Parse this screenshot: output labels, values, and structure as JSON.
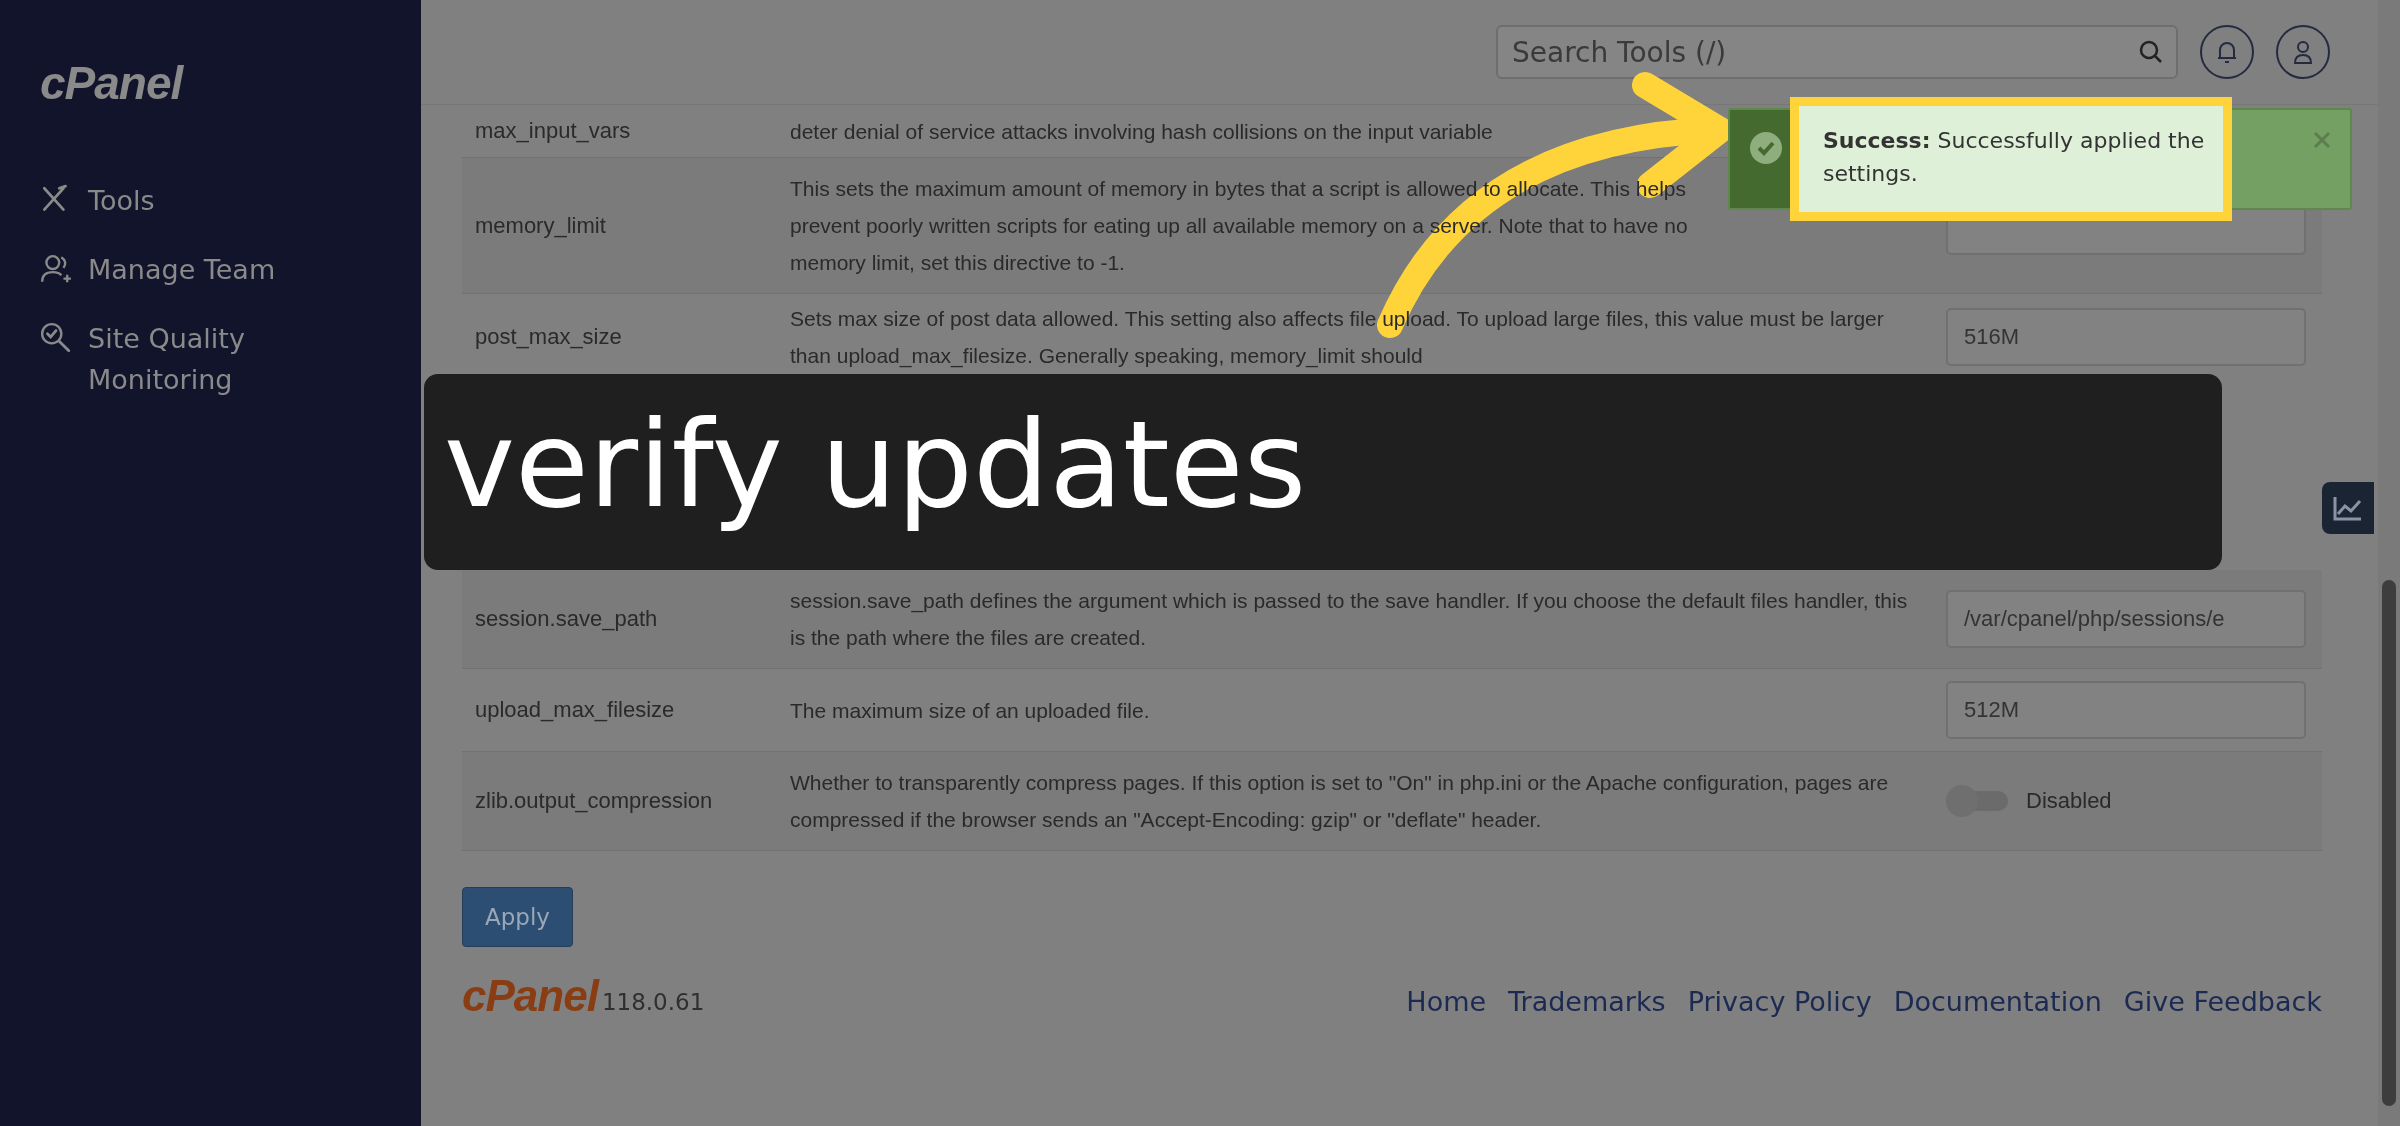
{
  "sidebar": {
    "logo": "cPanel",
    "items": [
      {
        "label": "Tools"
      },
      {
        "label": "Manage Team"
      },
      {
        "label": "Site Quality Monitoring"
      }
    ]
  },
  "header": {
    "search": {
      "placeholder": "Search Tools (/)"
    }
  },
  "settings": [
    {
      "name": "max_input_vars",
      "description": "deter denial of service attacks involving hash collisions on the input variable"
    },
    {
      "name": "memory_limit",
      "description": "This sets the maximum amount of memory in bytes that a script is allowed to allocate. This helps prevent poorly written scripts for eating up all available memory on a server. Note that to have no memory limit, set this directive to -1.",
      "kind": "text"
    },
    {
      "name": "post_max_size",
      "description": "Sets max size of post data allowed. This setting also affects file upload. To upload large files, this value must be larger than upload_max_filesize. Generally speaking, memory_limit should",
      "kind": "text",
      "value": "516M"
    },
    {
      "name": "session.save_path",
      "description": "session.save_path defines the argument which is passed to the save handler. If you choose the default files handler, this is the path where the files are created.",
      "kind": "text",
      "value": "/var/cpanel/php/sessions/e"
    },
    {
      "name": "upload_max_filesize",
      "description": "The maximum size of an uploaded file.",
      "kind": "text",
      "value": "512M"
    },
    {
      "name": "zlib.output_compression",
      "description": "Whether to transparently compress pages. If this option is set to \"On\" in php.ini or the Apache configuration, pages are compressed if the browser sends an \"Accept-Encoding: gzip\" or \"deflate\" header.",
      "kind": "toggle",
      "on": false,
      "label": "Disabled"
    }
  ],
  "apply_button": "Apply",
  "footer": {
    "logo": "cPanel",
    "version": "118.0.61",
    "links": [
      "Home",
      "Trademarks",
      "Privacy Policy",
      "Documentation",
      "Give Feedback"
    ]
  },
  "toast": {
    "message": "**Success:** Successfully applied the settings."
  },
  "annotation": {
    "caption": "verify updates"
  }
}
